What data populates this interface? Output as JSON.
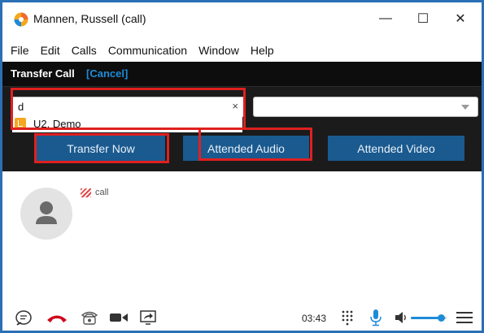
{
  "window": {
    "title": "Mannen, Russell (call)",
    "minimize_glyph": "—",
    "maximize_glyph": "☐",
    "close_glyph": "✕"
  },
  "menu": [
    "File",
    "Edit",
    "Calls",
    "Communication",
    "Window",
    "Help"
  ],
  "transfer": {
    "title": "Transfer Call",
    "cancel": "[Cancel]",
    "search_value": "d",
    "clear_glyph": "×",
    "suggestion": "U2, Demo",
    "buttons": {
      "transfer_now": "Transfer Now",
      "attended_audio": "Attended Audio",
      "attended_video": "Attended Video"
    }
  },
  "call": {
    "status_label": "call"
  },
  "toolbar": {
    "timer": "03:43",
    "icons": [
      "chat-icon",
      "hangup-icon",
      "phone-icon",
      "video-icon",
      "screen-share-icon",
      "keypad-icon",
      "microphone-icon",
      "speaker-icon",
      "menu-icon"
    ],
    "volume_fraction": 0.85
  },
  "colors": {
    "accent": "#1e8bd8",
    "button_bg": "#1a5a8f",
    "highlight": "#e02020",
    "hangup": "#d0021b"
  }
}
